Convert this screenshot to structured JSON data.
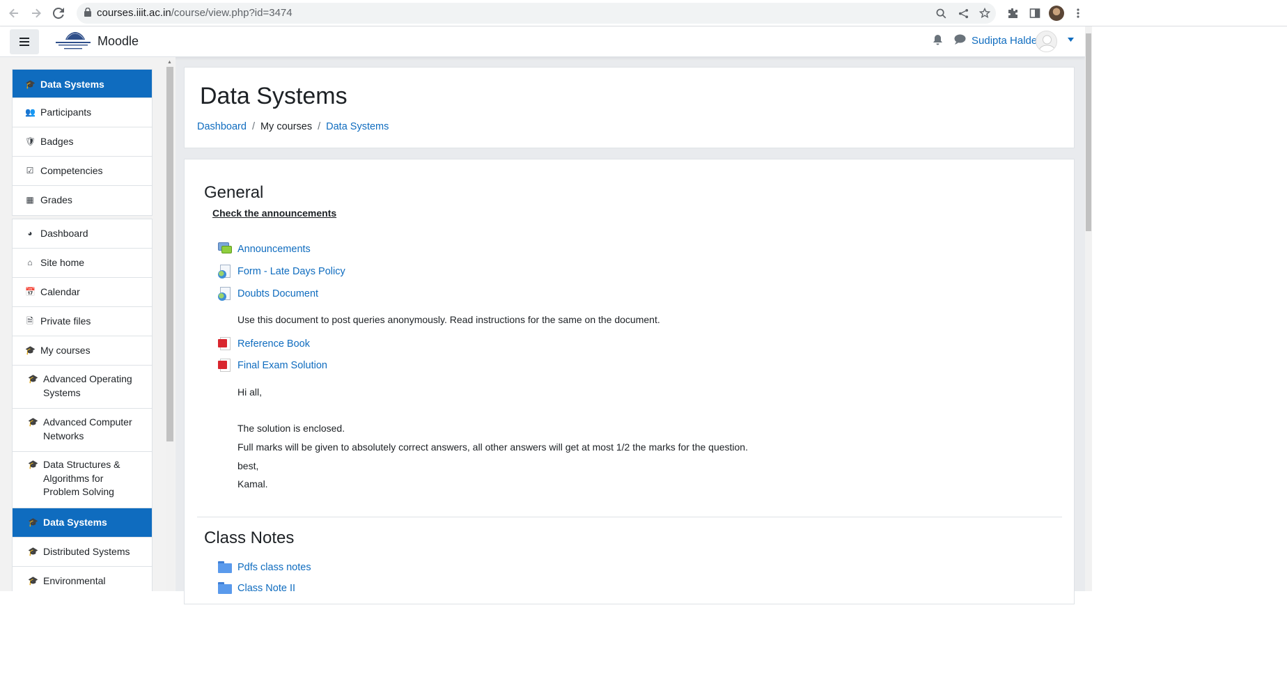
{
  "browser": {
    "url_host": "courses.iiit.ac.in",
    "url_path": "/course/view.php?id=3474",
    "back_icon": "arrow-left-icon",
    "forward_icon": "arrow-right-icon",
    "reload_icon": "reload-icon"
  },
  "navbar": {
    "brand": "Moodle",
    "user_name": "Sudipta Halder"
  },
  "drawer": {
    "course_items": [
      {
        "label": "Data Systems",
        "icon": "graduation-cap-icon",
        "active": true
      },
      {
        "label": "Participants",
        "icon": "users-icon"
      },
      {
        "label": "Badges",
        "icon": "shield-icon"
      },
      {
        "label": "Competencies",
        "icon": "check-square-icon"
      },
      {
        "label": "Grades",
        "icon": "table-icon"
      }
    ],
    "site_items": [
      {
        "label": "Dashboard",
        "icon": "tachometer-icon"
      },
      {
        "label": "Site home",
        "icon": "home-icon"
      },
      {
        "label": "Calendar",
        "icon": "calendar-icon"
      },
      {
        "label": "Private files",
        "icon": "file-icon"
      },
      {
        "label": "My courses",
        "icon": "graduation-cap-icon"
      },
      {
        "label": "Advanced Operating Systems",
        "icon": "graduation-cap-icon",
        "sub": true
      },
      {
        "label": "Advanced Computer Networks",
        "icon": "graduation-cap-icon",
        "sub": true
      },
      {
        "label": "Data Structures & Algorithms for Problem Solving",
        "icon": "graduation-cap-icon",
        "sub": true
      },
      {
        "label": "Data Systems",
        "icon": "graduation-cap-icon",
        "sub": true,
        "active": true
      },
      {
        "label": "Distributed Systems",
        "icon": "graduation-cap-icon",
        "sub": true
      },
      {
        "label": "Environmental Science & Technology",
        "icon": "graduation-cap-icon",
        "sub": true
      }
    ]
  },
  "header": {
    "title": "Data Systems",
    "breadcrumb": [
      "Dashboard",
      "My courses",
      "Data Systems"
    ]
  },
  "general": {
    "title": "General",
    "announcement_link": "Check the announcements",
    "activities": [
      {
        "label": "Announcements",
        "type": "forum"
      },
      {
        "label": "Form - Late Days Policy",
        "type": "url"
      },
      {
        "label": "Doubts Document",
        "type": "url"
      },
      {
        "label": "Reference Book",
        "type": "pdf"
      },
      {
        "label": "Final Exam Solution",
        "type": "pdf"
      }
    ],
    "doubts_description": "Use this document to post queries anonymously. Read instructions for the same on the document.",
    "solution_text": [
      "Hi all,",
      "The solution is enclosed.",
      "Full marks will be given to absolutely correct answers, all other answers will get at most 1/2 the marks for the question.",
      "best,",
      "Kamal."
    ]
  },
  "class_notes": {
    "title": "Class Notes",
    "folders": [
      "Pdfs class notes",
      "Class Note II"
    ]
  }
}
